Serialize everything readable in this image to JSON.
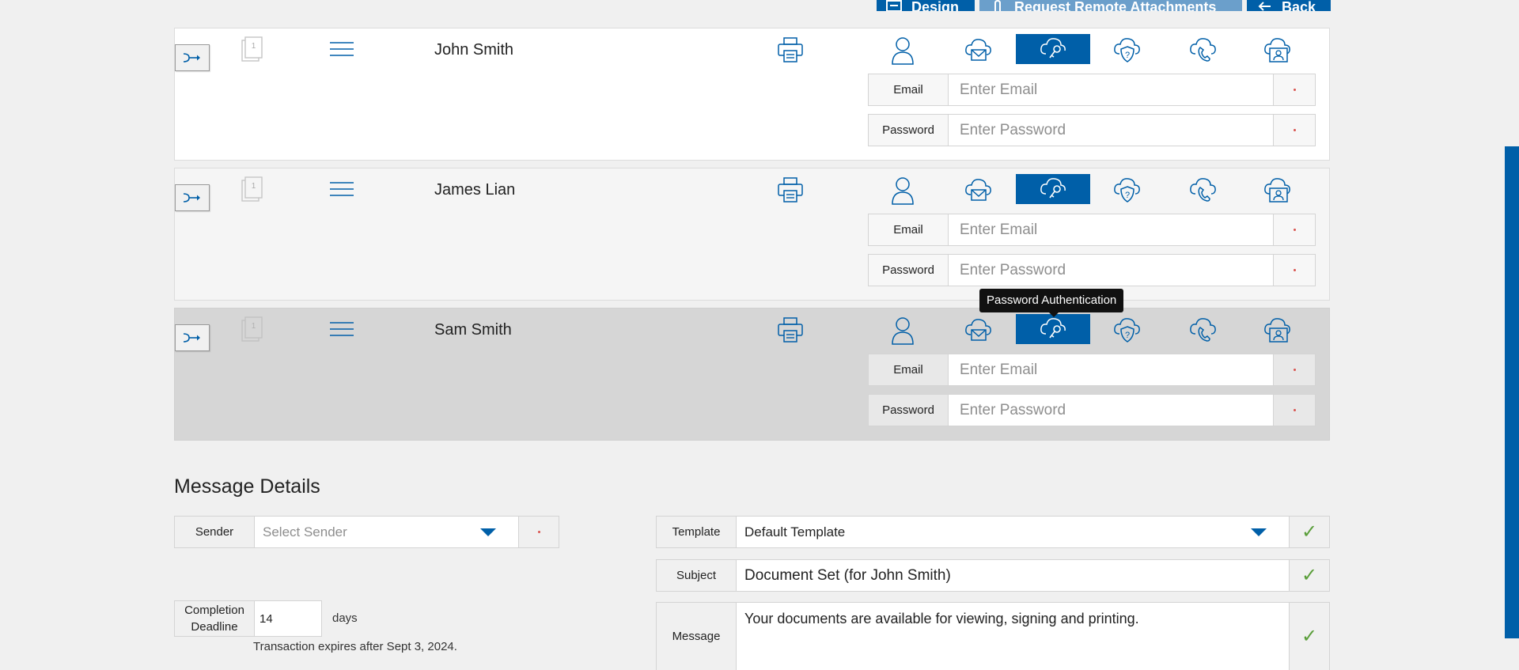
{
  "toolbar": {
    "design_label": "Design",
    "remote_label": "Request Remote Attachments",
    "back_label": "Back"
  },
  "recipients": [
    {
      "name": "John Smith",
      "email_label": "Email",
      "email_placeholder": "Enter Email",
      "password_label": "Password",
      "password_placeholder": "Enter Password"
    },
    {
      "name": "James Lian",
      "email_label": "Email",
      "email_placeholder": "Enter Email",
      "password_label": "Password",
      "password_placeholder": "Enter Password"
    },
    {
      "name": "Sam Smith",
      "email_label": "Email",
      "email_placeholder": "Enter Email",
      "password_label": "Password",
      "password_placeholder": "Enter Password"
    }
  ],
  "doc_count": "1",
  "tooltip": "Password Authentication",
  "message_details": {
    "title": "Message Details",
    "sender_label": "Sender",
    "sender_placeholder": "Select Sender",
    "template_label": "Template",
    "template_value": "Default Template",
    "subject_label": "Subject",
    "subject_value": "Document Set (for John Smith)",
    "message_label": "Message",
    "message_value": "Your documents are available for viewing, signing and printing.",
    "deadline_label_1": "Completion",
    "deadline_label_2": "Deadline",
    "deadline_value": "14",
    "days_label": "days",
    "expires_text": "Transaction expires after Sept 3, 2024."
  },
  "colors": {
    "accent": "#005fa8",
    "accent_light": "#6b9fcb",
    "check": "#5a9e3a",
    "required": "#d9534f"
  }
}
